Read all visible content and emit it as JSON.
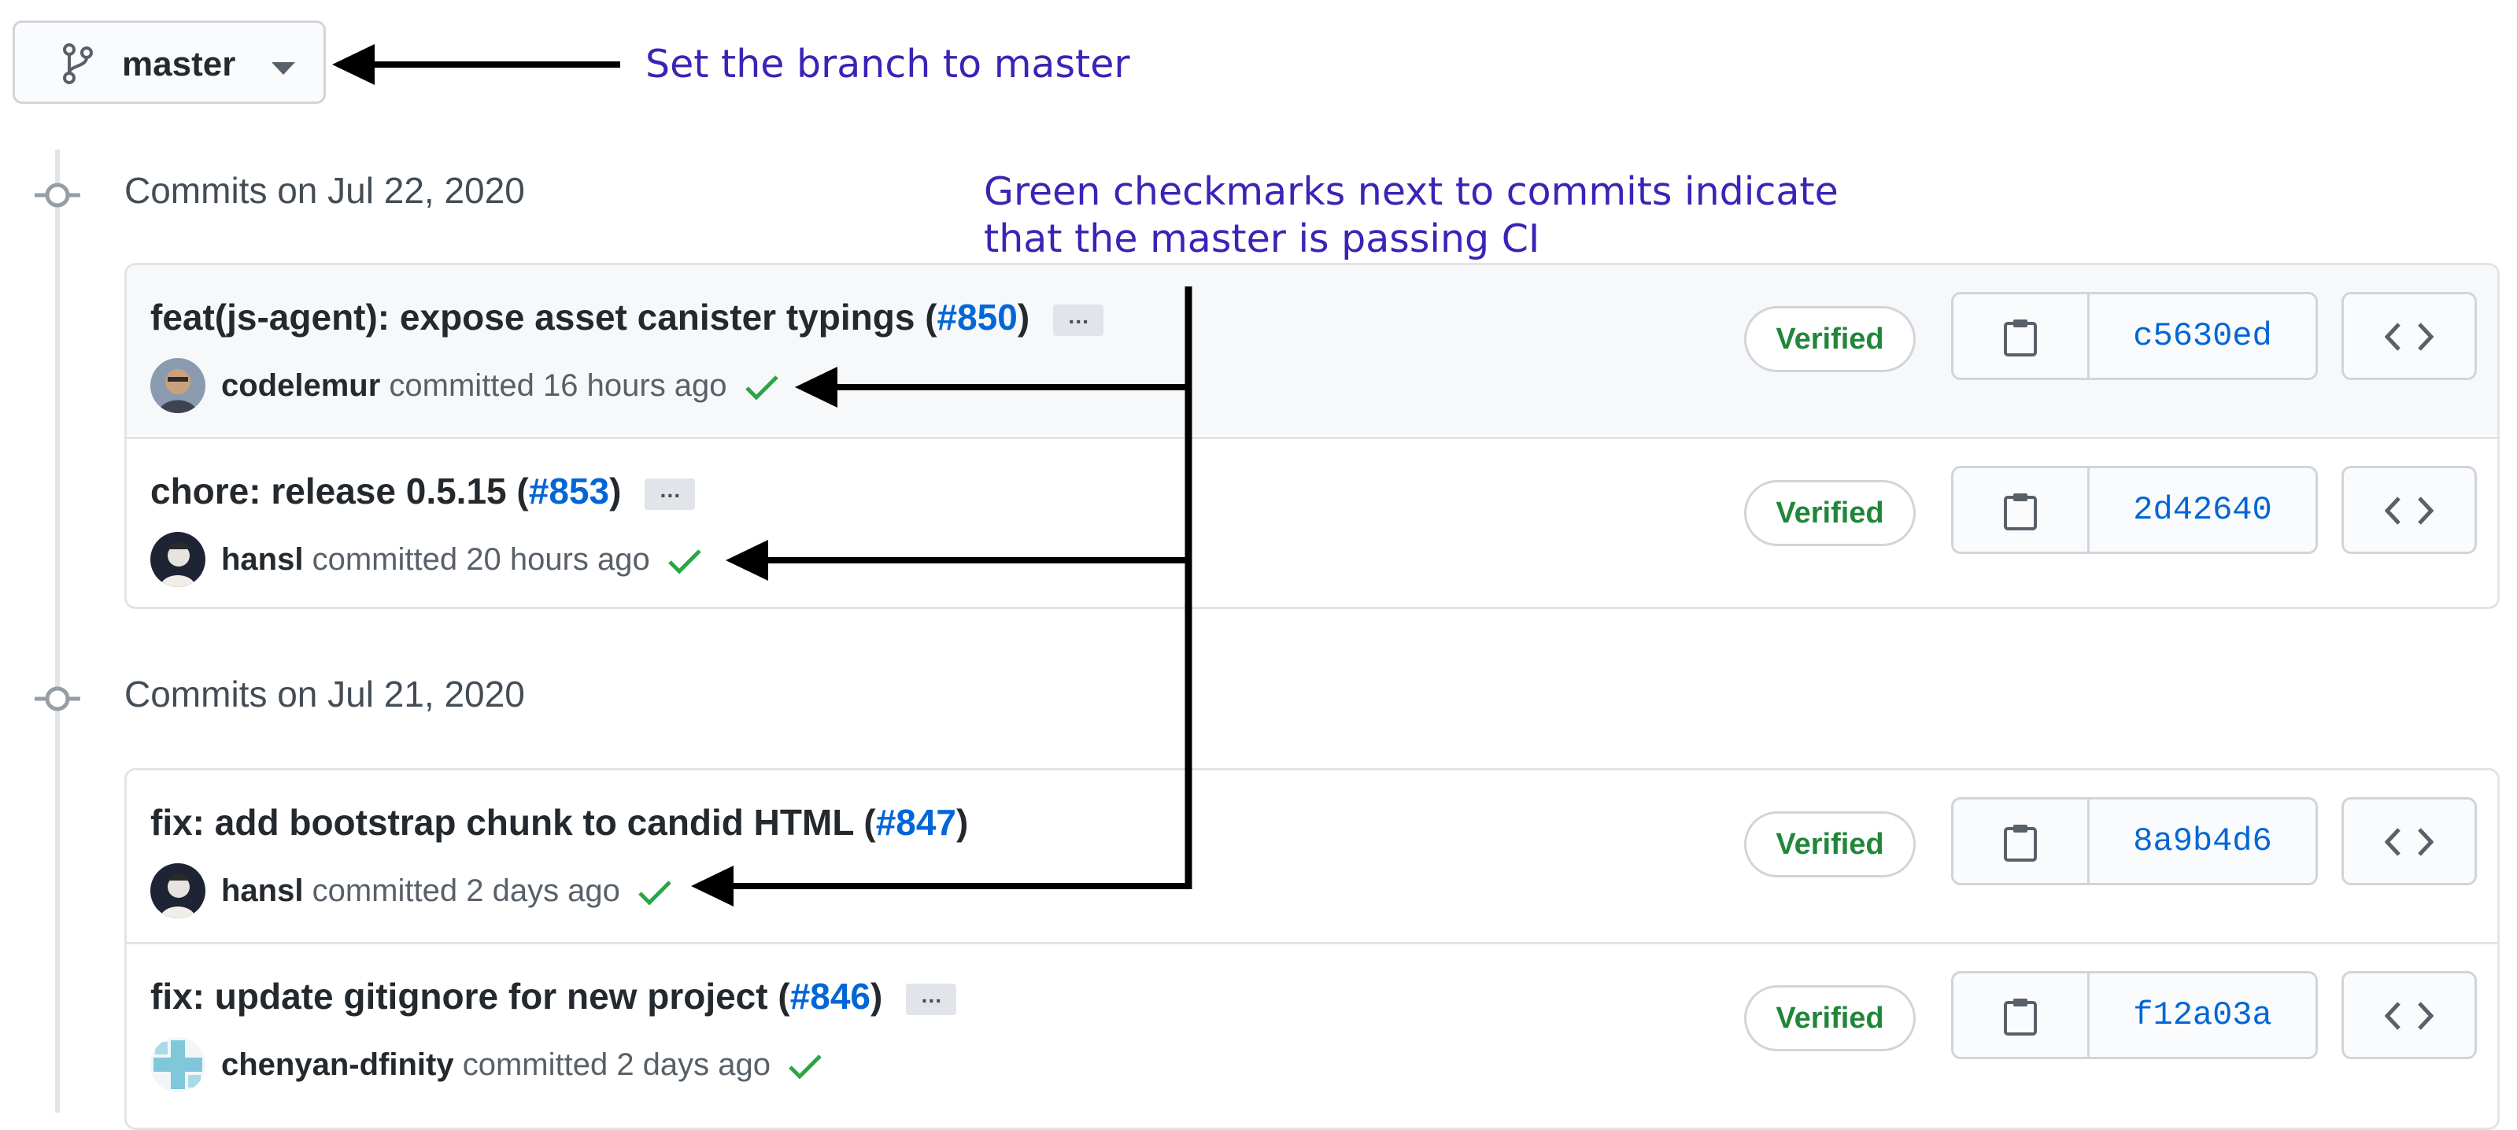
{
  "branch": {
    "name": "master"
  },
  "annotations": {
    "branch_note": "Set the branch to master",
    "ci_note_line1": "Green checkmarks next to commits indicate",
    "ci_note_line2": "that the master is passing CI"
  },
  "groups": [
    {
      "heading": "Commits on Jul 22, 2020",
      "commits": [
        {
          "message": "feat(js-agent): expose asset canister typings (",
          "pr": "#850",
          "close": ")",
          "has_ellipsis": true,
          "ellipsis": "…",
          "author": "codelemur",
          "time": "committed 16 hours ago",
          "verified": "Verified",
          "sha": "c5630ed"
        },
        {
          "message": "chore: release 0.5.15 (",
          "pr": "#853",
          "close": ")",
          "has_ellipsis": true,
          "ellipsis": "…",
          "author": "hansl",
          "time": "committed 20 hours ago",
          "verified": "Verified",
          "sha": "2d42640"
        }
      ]
    },
    {
      "heading": "Commits on Jul 21, 2020",
      "commits": [
        {
          "message": "fix: add bootstrap chunk to candid HTML (",
          "pr": "#847",
          "close": ")",
          "has_ellipsis": false,
          "author": "hansl",
          "time": "committed 2 days ago",
          "verified": "Verified",
          "sha": "8a9b4d6"
        },
        {
          "message": "fix: update gitignore for new project (",
          "pr": "#846",
          "close": ")",
          "has_ellipsis": true,
          "ellipsis": "…",
          "author": "chenyan-dfinity",
          "time": "committed 2 days ago",
          "verified": "Verified",
          "sha": "f12a03a"
        }
      ]
    }
  ],
  "icons": {
    "branch": "git-branch-icon",
    "copy": "clipboard-icon",
    "browse": "code-icon",
    "ci": "checkmark-icon",
    "timeline": "commit-node-icon"
  },
  "colors": {
    "annotation": "#3a24b6",
    "link": "#0366d6",
    "verified": "#22863a",
    "check": "#28a745"
  }
}
